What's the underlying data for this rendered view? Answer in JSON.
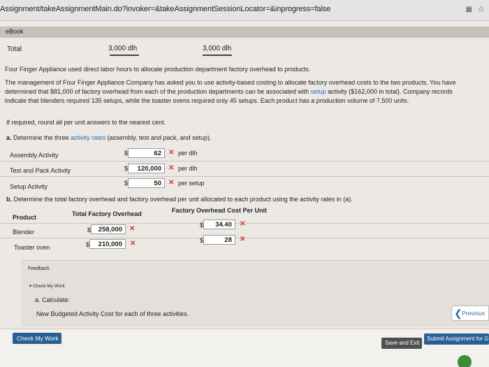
{
  "browser": {
    "url": "Assignment/takeAssignmentMain.do?invoker=&takeAssignmentSessionLocator=&inprogress=false",
    "extension_icon": "grid-icon",
    "bookmark_icon": "star-icon"
  },
  "ebook_tab": "eBook",
  "total_row": {
    "label": "Total",
    "value1": "3,000 dlh",
    "value2": "3,000 dlh"
  },
  "intro": "Four Finger Appliance used direct labor hours to allocate production department factory overhead to products.",
  "paragraph": {
    "line1": "The management of Four Finger Appliance Company has asked you to use activity-based costing to allocate factory overhead costs to the two products. You have",
    "line2_a": "determined that $81,000 of factory overhead from each of the production departments can be associated with ",
    "line2_link": "setup",
    "line2_b": " activity ($162,000 in total). Company records",
    "line3": "indicate that blenders required 135 setups, while the toaster ovens required only 45 setups. Each product has a production volume of 7,500 units."
  },
  "rounding_note": "If required, round all per unit answers to the nearest cent.",
  "part_a": {
    "prefix": "a.",
    "text_a": " Determine the three ",
    "link": "activity rates",
    "text_b": " (assembly, test and pack, and setup).",
    "rows": [
      {
        "label": "Assembly Activity",
        "currency": "$",
        "value": "62",
        "unit": "per dlh"
      },
      {
        "label": "Test and Pack Activity",
        "currency": "$",
        "value": "120,000",
        "unit": "per dlh"
      },
      {
        "label": "Setup Activity",
        "currency": "$",
        "value": "50",
        "unit": "per setup"
      }
    ]
  },
  "part_b": {
    "prefix": "b.",
    "text": " Determine the total factory overhead and factory overhead per unit allocated to each product using the activity rates in (a).",
    "headers": {
      "product": "Product",
      "total": "Total Factory Overhead",
      "per_unit": "Factory Overhead Cost Per Unit"
    },
    "rows": [
      {
        "product": "Blender",
        "currency": "$",
        "total": "258,000",
        "per_unit_currency": "$",
        "per_unit": "34.40"
      },
      {
        "product": "Toaster oven",
        "currency": "$",
        "total": "210,000",
        "per_unit_currency": "$",
        "per_unit": "28"
      }
    ]
  },
  "x_mark": "✕",
  "feedback": {
    "title": "Feedback",
    "toggle": "▾ Check My Work",
    "item": "a. Calculate:",
    "detail": "New Budgeted Activity Cost for each of three activities."
  },
  "nav": {
    "previous": "Previous",
    "previous_chevron": "❮"
  },
  "buttons": {
    "check": "Check My Work",
    "save": "Save and Exit",
    "submit": "Submit Assignment for Grading"
  },
  "colors": {
    "link_blue": "#2b6aa8",
    "error_red": "#d23b2b",
    "button_blue": "#2a5f96"
  }
}
